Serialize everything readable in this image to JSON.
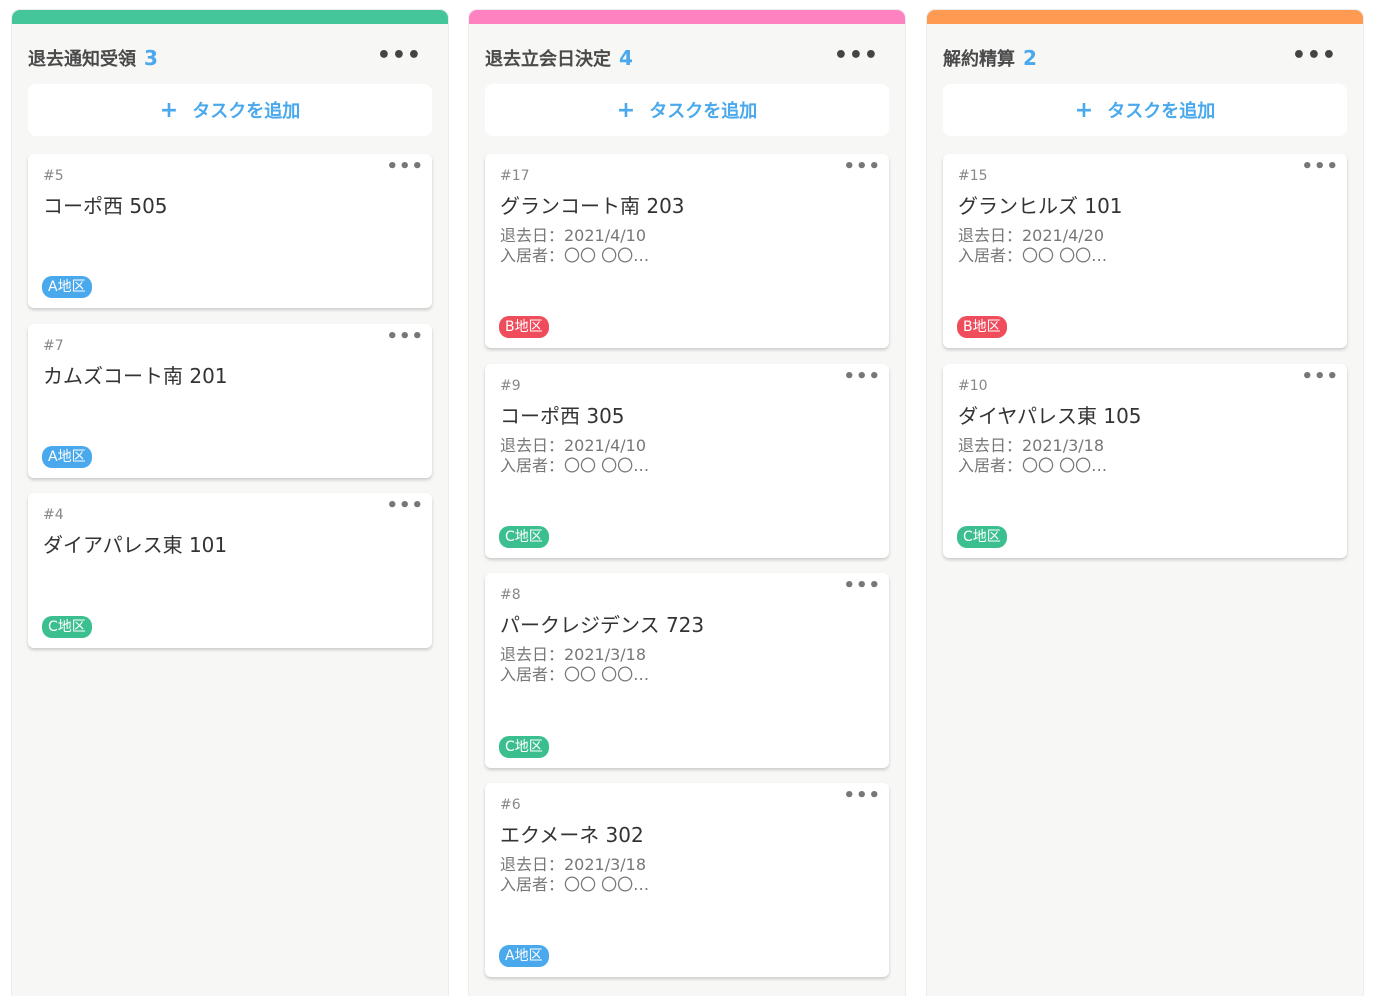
{
  "board": {
    "add_task_label": "タスクを追加",
    "add_icon": "+",
    "menu_icon": "•••",
    "columns": [
      {
        "title": "退去通知受領",
        "count": "3",
        "color": "#45c59a",
        "cards": [
          {
            "num": "#5",
            "title": "コーポ西 505",
            "tag": "A地区",
            "tag_color": "#4aa8ec"
          },
          {
            "num": "#7",
            "title": "カムズコート南 201",
            "tag": "A地区",
            "tag_color": "#4aa8ec"
          },
          {
            "num": "#4",
            "title": "ダイアパレス東 101",
            "tag": "C地区",
            "tag_color": "#3cbf8f"
          }
        ]
      },
      {
        "title": "退去立会日決定",
        "count": "4",
        "color": "#ff82c0",
        "cards": [
          {
            "num": "#17",
            "title": "グランコート南 203",
            "meta1": "退去日：2021/4/10",
            "meta2": "入居者：〇〇 〇〇…",
            "tag": "B地区",
            "tag_color": "#ef4c5c"
          },
          {
            "num": "#9",
            "title": "コーポ西 305",
            "meta1": "退去日：2021/4/10",
            "meta2": "入居者：〇〇 〇〇…",
            "tag": "C地区",
            "tag_color": "#3cbf8f"
          },
          {
            "num": "#8",
            "title": "パークレジデンス 723",
            "meta1": "退去日：2021/3/18",
            "meta2": "入居者：〇〇 〇〇…",
            "tag": "C地区",
            "tag_color": "#3cbf8f"
          },
          {
            "num": "#6",
            "title": "エクメーネ 302",
            "meta1": "退去日：2021/3/18",
            "meta2": "入居者：〇〇 〇〇…",
            "tag": "A地区",
            "tag_color": "#4aa8ec"
          }
        ]
      },
      {
        "title": "解約精算",
        "count": "2",
        "color": "#ff9a52",
        "cards": [
          {
            "num": "#15",
            "title": "グランヒルズ 101",
            "meta1": "退去日：2021/4/20",
            "meta2": "入居者：〇〇 〇〇…",
            "tag": "B地区",
            "tag_color": "#ef4c5c"
          },
          {
            "num": "#10",
            "title": "ダイヤパレス東 105",
            "meta1": "退去日：2021/3/18",
            "meta2": "入居者：〇〇 〇〇…",
            "tag": "C地区",
            "tag_color": "#3cbf8f"
          }
        ]
      }
    ]
  }
}
